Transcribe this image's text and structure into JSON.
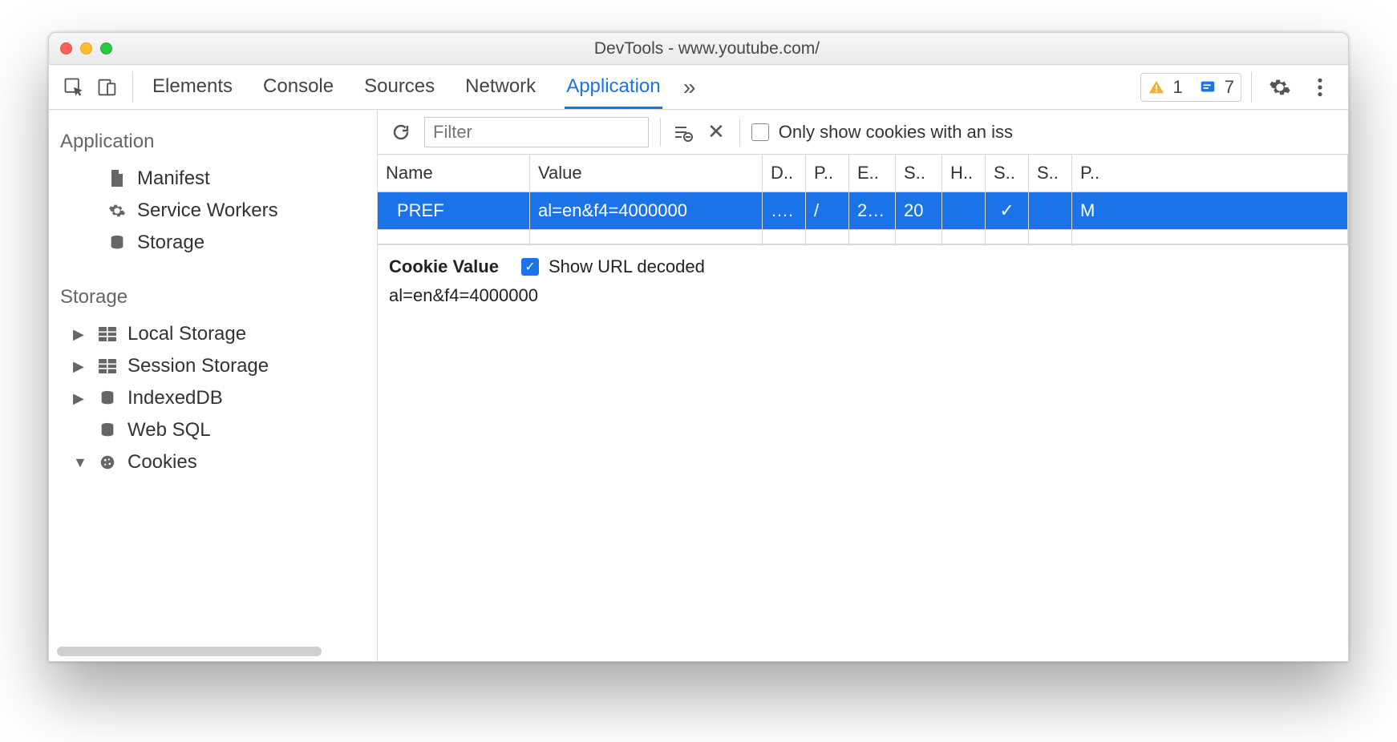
{
  "window": {
    "title": "DevTools - www.youtube.com/"
  },
  "tabs": {
    "items": [
      "Elements",
      "Console",
      "Sources",
      "Network",
      "Application"
    ],
    "active_index": 4,
    "more_symbol": "»"
  },
  "badges": {
    "warnings": "1",
    "messages": "7"
  },
  "sidebar": {
    "sections": [
      {
        "title": "Application",
        "items": [
          {
            "label": "Manifest",
            "icon": "file"
          },
          {
            "label": "Service Workers",
            "icon": "gear"
          },
          {
            "label": "Storage",
            "icon": "db"
          }
        ]
      },
      {
        "title": "Storage",
        "items": [
          {
            "label": "Local Storage",
            "icon": "grid",
            "expandable": true
          },
          {
            "label": "Session Storage",
            "icon": "grid",
            "expandable": true
          },
          {
            "label": "IndexedDB",
            "icon": "db",
            "expandable": true
          },
          {
            "label": "Web SQL",
            "icon": "db",
            "expandable": false
          },
          {
            "label": "Cookies",
            "icon": "cookie",
            "expandable": true,
            "expanded": true
          }
        ]
      }
    ]
  },
  "toolbar": {
    "filter_placeholder": "Filter",
    "issues_label": "Only show cookies with an iss"
  },
  "table": {
    "headers": [
      "Name",
      "Value",
      "D..",
      "P..",
      "E..",
      "S..",
      "H..",
      "S..",
      "S..",
      "P.."
    ],
    "rows": [
      {
        "cells": [
          "PREF",
          "al=en&f4=4000000",
          "….",
          "/",
          "2…",
          "20",
          "",
          "✓",
          "",
          "M"
        ],
        "selected": true
      }
    ]
  },
  "detail": {
    "title": "Cookie Value",
    "decode_label": "Show URL decoded",
    "decode_checked": true,
    "value": "al=en&f4=4000000"
  }
}
